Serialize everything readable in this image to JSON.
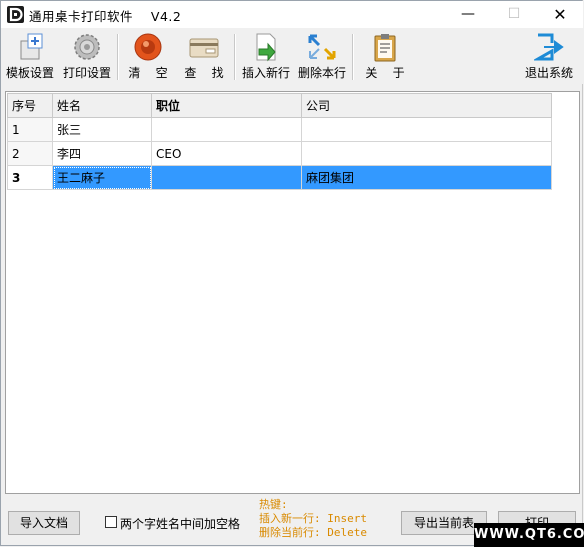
{
  "window": {
    "title": "通用桌卡打印软件    V4.2",
    "controls": {
      "minimize": "—",
      "maximize": "☐",
      "close": "✕"
    }
  },
  "toolbar": {
    "items": [
      {
        "label": "模板设置",
        "icon": "template-icon"
      },
      {
        "label": "打印设置",
        "icon": "gear-icon"
      },
      {
        "label": "清    空",
        "icon": "clear-icon"
      },
      {
        "label": "查    找",
        "icon": "search-card-icon"
      },
      {
        "label": "插入新行",
        "icon": "insert-row-icon"
      },
      {
        "label": "删除本行",
        "icon": "delete-row-icon"
      },
      {
        "label": "关    于",
        "icon": "clipboard-icon"
      },
      {
        "label": "退出系统",
        "icon": "exit-icon"
      }
    ]
  },
  "grid": {
    "columns": [
      "序号",
      "姓名",
      "职位",
      "公司"
    ],
    "rows": [
      {
        "no": "1",
        "name": "张三",
        "title": "",
        "company": ""
      },
      {
        "no": "2",
        "name": "李四",
        "title": "CEO",
        "company": ""
      },
      {
        "no": "3",
        "name": "王二麻子",
        "title": "",
        "company": "麻团集团"
      }
    ],
    "selected_row": 3
  },
  "bottom": {
    "import_label": "导入文档",
    "space_checkbox_label": "两个字姓名中间加空格",
    "space_checkbox_checked": false,
    "hotkeys": {
      "title": "热键:",
      "insert": "插入新一行: Insert",
      "delete": "删除当前行: Delete"
    },
    "export_label": "导出当前表",
    "print_label": "打印"
  },
  "watermark": "WWW.QT6.COM",
  "colors": {
    "selection": "#3399ff",
    "hotkey_text": "#d98a00"
  }
}
